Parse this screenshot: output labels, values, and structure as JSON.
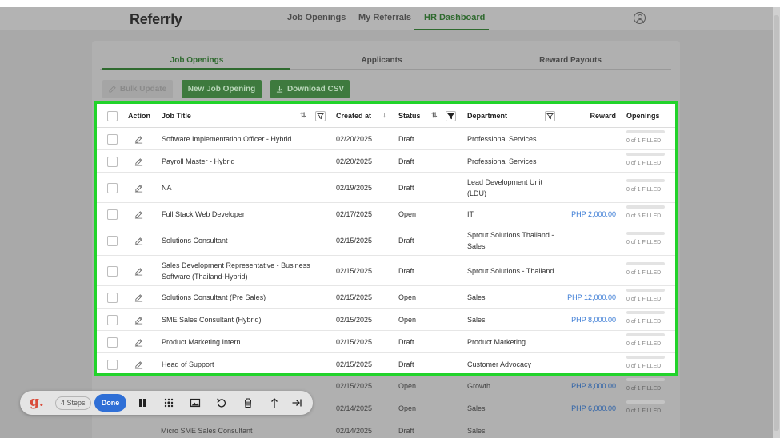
{
  "app": {
    "logo": "Referrly",
    "nav": [
      {
        "label": "Job Openings"
      },
      {
        "label": "My Referrals"
      },
      {
        "label": "HR Dashboard",
        "active": true
      }
    ]
  },
  "tabs": [
    {
      "label": "Job Openings",
      "active": true
    },
    {
      "label": "Applicants"
    },
    {
      "label": "Reward Payouts"
    }
  ],
  "actions": {
    "bulk_update": "Bulk Update",
    "new_job_opening": "New Job Opening",
    "download_csv": "Download CSV"
  },
  "table": {
    "columns": {
      "action": "Action",
      "job_title": "Job Title",
      "created_at": "Created at",
      "status": "Status",
      "department": "Department",
      "reward": "Reward",
      "openings": "Openings"
    },
    "rows": [
      {
        "title": "Software Implementation Officer - Hybrid",
        "created": "02/20/2025",
        "status": "Draft",
        "department": "Professional Services",
        "reward": "",
        "openings": "0 of 1 FILLED"
      },
      {
        "title": "Payroll Master - Hybrid",
        "created": "02/20/2025",
        "status": "Draft",
        "department": "Professional Services",
        "reward": "",
        "openings": "0 of 1 FILLED"
      },
      {
        "title": "NA",
        "created": "02/19/2025",
        "status": "Draft",
        "department": "Lead Development Unit (LDU)",
        "reward": "",
        "openings": "0 of 1 FILLED"
      },
      {
        "title": "Full Stack Web Developer",
        "created": "02/17/2025",
        "status": "Open",
        "department": "IT",
        "reward": "PHP 2,000.00",
        "openings": "0 of 5 FILLED"
      },
      {
        "title": "Solutions Consultant",
        "created": "02/15/2025",
        "status": "Draft",
        "department": "Sprout Solutions Thailand - Sales",
        "reward": "",
        "openings": "0 of 1 FILLED"
      },
      {
        "title": "Sales Development Representative - Business Software (Thailand-Hybrid)",
        "created": "02/15/2025",
        "status": "Draft",
        "department": "Sprout Solutions - Thailand",
        "reward": "",
        "openings": "0 of 1 FILLED"
      },
      {
        "title": "Solutions Consultant (Pre Sales)",
        "created": "02/15/2025",
        "status": "Open",
        "department": "Sales",
        "reward": "PHP 12,000.00",
        "openings": "0 of 1 FILLED"
      },
      {
        "title": "SME Sales Consultant (Hybrid)",
        "created": "02/15/2025",
        "status": "Open",
        "department": "Sales",
        "reward": "PHP 8,000.00",
        "openings": "0 of 1 FILLED"
      },
      {
        "title": "Product Marketing Intern",
        "created": "02/15/2025",
        "status": "Draft",
        "department": "Product Marketing",
        "reward": "",
        "openings": "0 of 1 FILLED"
      },
      {
        "title": "Head of Support",
        "created": "02/15/2025",
        "status": "Draft",
        "department": "Customer Advocacy",
        "reward": "",
        "openings": "0 of 1 FILLED"
      }
    ],
    "rows_below": [
      {
        "title": "",
        "created": "02/15/2025",
        "status": "Open",
        "department": "Growth",
        "reward": "PHP 8,000.00",
        "openings": "0 of 1 FILLED"
      },
      {
        "title": "",
        "created": "02/14/2025",
        "status": "Open",
        "department": "Sales",
        "reward": "PHP 6,000.00",
        "openings": "0 of 1 FILLED"
      },
      {
        "title": "Micro SME Sales Consultant",
        "created": "02/14/2025",
        "status": "Draft",
        "department": "Sales",
        "reward": "",
        "openings": ""
      }
    ]
  },
  "recorder": {
    "logo": "g.",
    "steps": "4 Steps",
    "done": "Done",
    "icons": [
      "pause-icon",
      "blur-icon",
      "image-icon",
      "undo-icon",
      "trash-icon",
      "share-icon",
      "skip-end-icon"
    ]
  },
  "colors": {
    "accent_green": "#2f6a2f",
    "highlight_frame": "#22d32b",
    "reward_blue": "#3a7bd5",
    "done_blue": "#2f6fd6"
  }
}
